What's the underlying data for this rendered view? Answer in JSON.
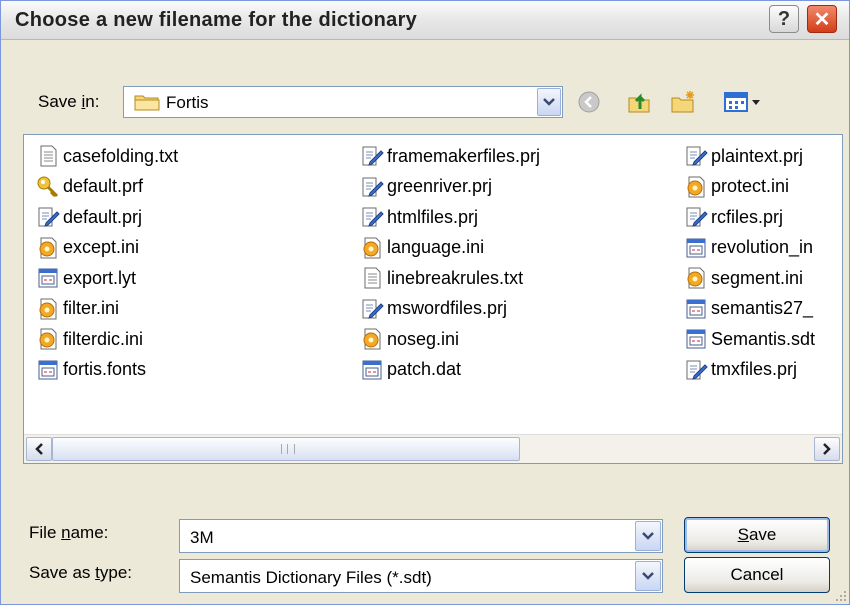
{
  "window": {
    "title": "Choose a new filename for the dictionary"
  },
  "save_in": {
    "label_pre": "Save ",
    "label_key": "i",
    "label_post": "n:",
    "value": "Fortis"
  },
  "files": [
    {
      "name": "casefolding.txt",
      "icon": "text-file-icon"
    },
    {
      "name": "default.prf",
      "icon": "key-icon"
    },
    {
      "name": "default.prj",
      "icon": "project-file-icon"
    },
    {
      "name": "except.ini",
      "icon": "config-file-icon"
    },
    {
      "name": "export.lyt",
      "icon": "window-file-icon"
    },
    {
      "name": "filter.ini",
      "icon": "config-file-icon"
    },
    {
      "name": "filterdic.ini",
      "icon": "config-file-icon"
    },
    {
      "name": "fortis.fonts",
      "icon": "window-file-icon"
    },
    {
      "name": "framemakerfiles.prj",
      "icon": "project-file-icon"
    },
    {
      "name": "greenriver.prj",
      "icon": "project-file-icon"
    },
    {
      "name": "htmlfiles.prj",
      "icon": "project-file-icon"
    },
    {
      "name": "language.ini",
      "icon": "config-file-icon"
    },
    {
      "name": "linebreakrules.txt",
      "icon": "text-file-icon"
    },
    {
      "name": "mswordfiles.prj",
      "icon": "project-file-icon"
    },
    {
      "name": "noseg.ini",
      "icon": "config-file-icon"
    },
    {
      "name": "patch.dat",
      "icon": "window-file-icon"
    },
    {
      "name": "plaintext.prj",
      "icon": "project-file-icon"
    },
    {
      "name": "protect.ini",
      "icon": "config-file-icon"
    },
    {
      "name": "rcfiles.prj",
      "icon": "project-file-icon"
    },
    {
      "name": "revolution_in",
      "icon": "window-file-icon"
    },
    {
      "name": "segment.ini",
      "icon": "config-file-icon"
    },
    {
      "name": "semantis27_",
      "icon": "window-file-icon"
    },
    {
      "name": "Semantis.sdt",
      "icon": "window-file-icon"
    },
    {
      "name": "tmxfiles.prj",
      "icon": "project-file-icon"
    }
  ],
  "file_name": {
    "label_pre": "File ",
    "label_key": "n",
    "label_post": "ame:",
    "value": "3M"
  },
  "save_as_type": {
    "label_pre": "Save as ",
    "label_key": "t",
    "label_post": "ype:",
    "value": "Semantis Dictionary Files (*.sdt)"
  },
  "buttons": {
    "save_key": "S",
    "save_rest": "ave",
    "cancel": "Cancel"
  },
  "colors": {
    "titlebar": "#e6e6e6",
    "dialog_bg": "#ece9d8",
    "border": "#7f9db9",
    "close_button": "#d43c18"
  }
}
